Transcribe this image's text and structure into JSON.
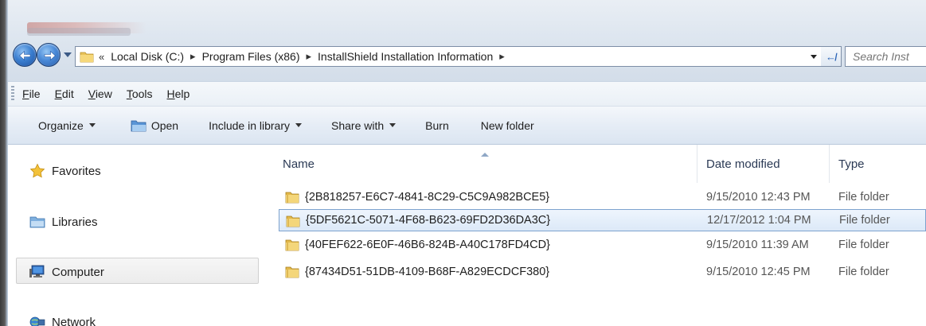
{
  "address_bar": {
    "overflow": "«",
    "crumbs": [
      "Local Disk (C:)",
      "Program Files (x86)",
      "InstallShield Installation Information"
    ]
  },
  "search": {
    "placeholder": "Search Inst"
  },
  "menu": {
    "file": "File",
    "edit": "Edit",
    "view": "View",
    "tools": "Tools",
    "help": "Help"
  },
  "commands": {
    "organize": "Organize",
    "open": "Open",
    "include_in_library": "Include in library",
    "share_with": "Share with",
    "burn": "Burn",
    "new_folder": "New folder"
  },
  "nav_pane": {
    "favorites": "Favorites",
    "libraries": "Libraries",
    "computer": "Computer",
    "network": "Network"
  },
  "columns": {
    "name": "Name",
    "date_modified": "Date modified",
    "type": "Type"
  },
  "files": [
    {
      "name": "{2B818257-E6C7-4841-8C29-C5C9A982BCE5}",
      "date": "9/15/2010 12:43 PM",
      "type": "File folder"
    },
    {
      "name": "{5DF5621C-5071-4F68-B623-69FD2D36DA3C}",
      "date": "12/17/2012 1:04 PM",
      "type": "File folder"
    },
    {
      "name": "{40FEF622-6E0F-46B6-824B-A40C178FD4CD}",
      "date": "9/15/2010 11:39 AM",
      "type": "File folder"
    },
    {
      "name": "{87434D51-51DB-4109-B68F-A829ECDCF380}",
      "date": "9/15/2010 12:45 PM",
      "type": "File folder"
    }
  ],
  "colors": {
    "selection_border": "#7da2ce",
    "selection_fill": "#dce9f8",
    "nav_button": "#3b7fd1"
  },
  "icons": [
    "back-arrow-icon",
    "forward-arrow-icon",
    "folder-icon",
    "refresh-icon",
    "star-icon",
    "library-icon",
    "computer-icon",
    "network-icon"
  ]
}
